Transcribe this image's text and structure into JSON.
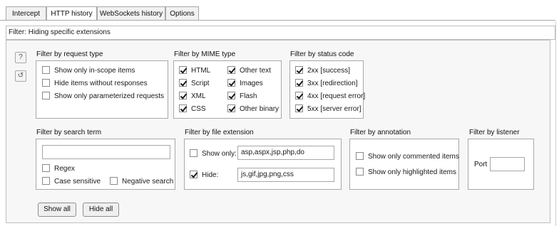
{
  "tabs": [
    {
      "label": "Intercept"
    },
    {
      "label": "HTTP history",
      "active": true
    },
    {
      "label": "WebSockets history"
    },
    {
      "label": "Options"
    }
  ],
  "filter_bar": {
    "text": "Filter: Hiding specific extensions"
  },
  "side_icons": {
    "help": "?",
    "restore": "↺"
  },
  "request_type": {
    "title": "Filter by request type",
    "options": [
      {
        "label": "Show only in-scope items",
        "checked": false
      },
      {
        "label": "Hide items without responses",
        "checked": false
      },
      {
        "label": "Show only parameterized requests",
        "checked": false
      }
    ]
  },
  "mime_type": {
    "title": "Filter by MIME type",
    "col1": [
      {
        "label": "HTML",
        "checked": true
      },
      {
        "label": "Script",
        "checked": true
      },
      {
        "label": "XML",
        "checked": true
      },
      {
        "label": "CSS",
        "checked": true
      }
    ],
    "col2": [
      {
        "label": "Other text",
        "checked": true
      },
      {
        "label": "Images",
        "checked": true
      },
      {
        "label": "Flash",
        "checked": true
      },
      {
        "label": "Other binary",
        "checked": true
      }
    ]
  },
  "status_code": {
    "title": "Filter by status code",
    "options": [
      {
        "label": "2xx  [success]",
        "checked": true
      },
      {
        "label": "3xx  [redirection]",
        "checked": true
      },
      {
        "label": "4xx  [request error]",
        "checked": true
      },
      {
        "label": "5xx  [server error]",
        "checked": true
      }
    ]
  },
  "search_term": {
    "title": "Filter by search term",
    "value": "",
    "regex": {
      "label": "Regex",
      "checked": false
    },
    "case_sensitive": {
      "label": "Case sensitive",
      "checked": false
    },
    "negative_search": {
      "label": "Negative search",
      "checked": false
    }
  },
  "file_extension": {
    "title": "Filter by file extension",
    "show_only": {
      "label": "Show only:",
      "checked": false,
      "value": "asp,aspx,jsp,php,do"
    },
    "hide": {
      "label": "Hide:",
      "checked": true,
      "value": "js,gif,jpg,png,css"
    }
  },
  "annotation": {
    "title": "Filter by annotation",
    "options": [
      {
        "label": "Show only commented items",
        "checked": false
      },
      {
        "label": "Show only highlighted items",
        "checked": false
      }
    ]
  },
  "listener": {
    "title": "Filter by listener",
    "port_label": "Port",
    "port_value": ""
  },
  "buttons": {
    "show_all": "Show all",
    "hide_all": "Hide all"
  }
}
